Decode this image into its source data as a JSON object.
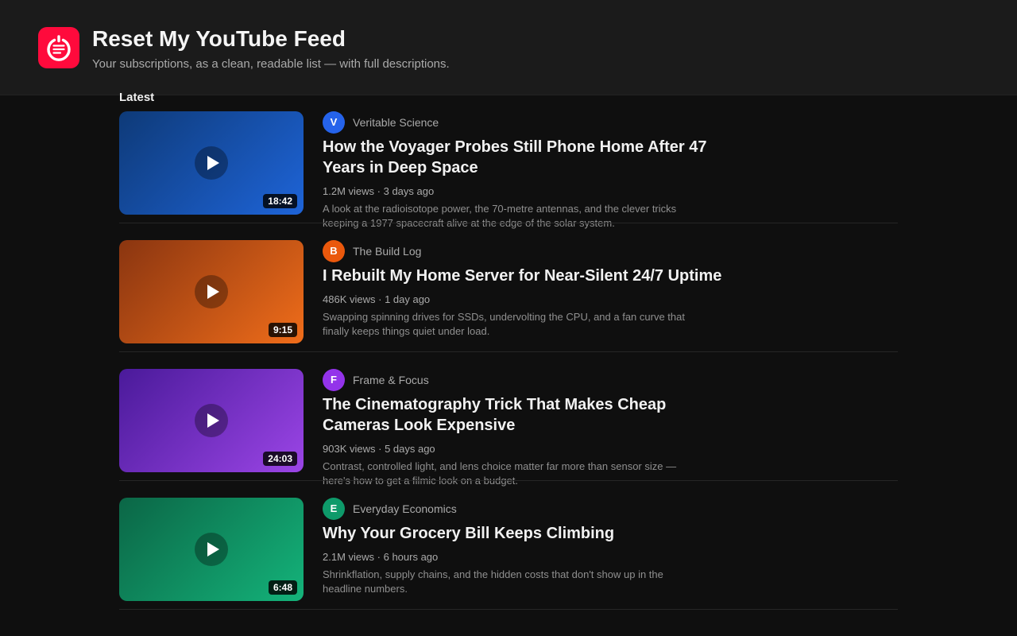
{
  "header": {
    "title": "Reset My YouTube Feed",
    "subtitle": "Your subscriptions, as a clean, readable list — with full descriptions.",
    "logo_icon": "feed-reset-icon",
    "brand_color": "#ff0a3c"
  },
  "section": {
    "label": "Latest"
  },
  "videos": [
    {
      "channel": "Veritable Science",
      "initial": "V",
      "avatar_color": "#2563eb",
      "title": "How the Voyager Probes Still Phone Home After 47 Years in Deep Space",
      "views": "1.2M views",
      "age": "3 days ago",
      "duration": "18:42",
      "description": "A look at the radioisotope power, the 70-metre antennas, and the clever tricks keeping a 1977 spacecraft alive at the edge of the solar system.",
      "thumb_colors": [
        "#0e3a78",
        "#1e64d8"
      ]
    },
    {
      "channel": "The Build Log",
      "initial": "B",
      "avatar_color": "#ea580c",
      "title": "I Rebuilt My Home Server for Near-Silent 24/7 Uptime",
      "views": "486K views",
      "age": "1 day ago",
      "duration": "9:15",
      "description": "Swapping spinning drives for SSDs, undervolting the CPU, and a fan curve that finally keeps things quiet under load.",
      "thumb_colors": [
        "#8a3510",
        "#f06d1a"
      ]
    },
    {
      "channel": "Frame & Focus",
      "initial": "F",
      "avatar_color": "#9333ea",
      "title": "The Cinematography Trick That Makes Cheap Cameras Look Expensive",
      "views": "903K views",
      "age": "5 days ago",
      "duration": "24:03",
      "description": "Contrast, controlled light, and lens choice matter far more than sensor size — here's how to get a filmic look on a budget.",
      "thumb_colors": [
        "#4a1a9a",
        "#9b45e6"
      ]
    },
    {
      "channel": "Everyday Economics",
      "initial": "E",
      "avatar_color": "#0e9a6a",
      "title": "Why Your Grocery Bill Keeps Climbing",
      "views": "2.1M views",
      "age": "6 hours ago",
      "duration": "6:48",
      "description": "Shrinkflation, supply chains, and the hidden costs that don't show up in the headline numbers.",
      "thumb_colors": [
        "#0b6646",
        "#14b37a"
      ]
    }
  ]
}
